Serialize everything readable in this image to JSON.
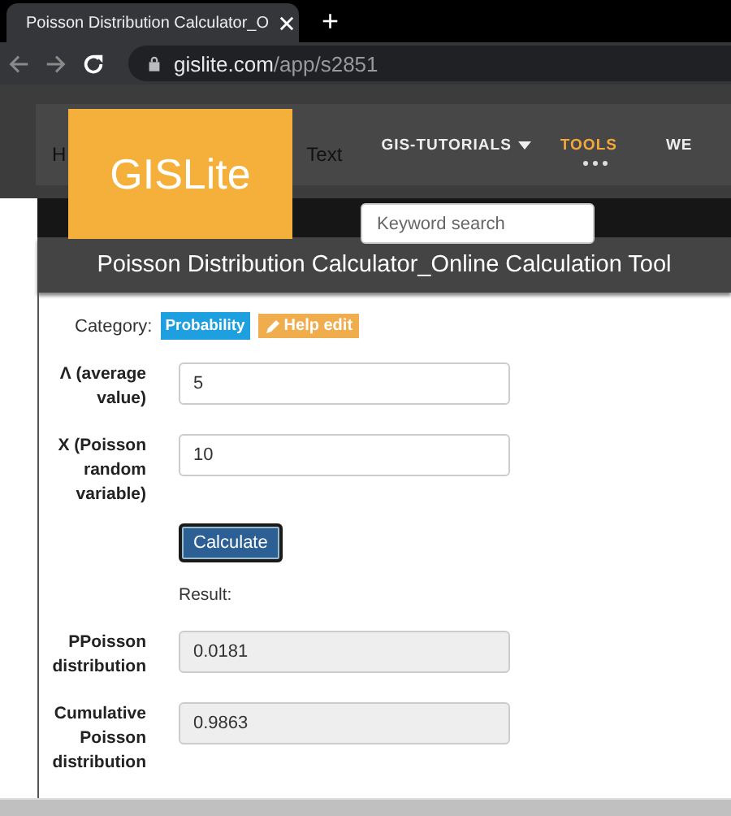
{
  "browser": {
    "tab_title": "Poisson Distribution Calculator_O",
    "new_tab": "+",
    "url_host": "gislite.com",
    "url_path": "/app/s2851"
  },
  "site": {
    "logo": "GISLite",
    "nav": [
      {
        "label": "H",
        "selected": false,
        "kind": "hidden"
      },
      {
        "label": "Text",
        "selected": false,
        "kind": "hidden"
      },
      {
        "label": "GIS-TUTORIALS",
        "selected": false,
        "kind": "dropdown"
      },
      {
        "label": "TOOLS",
        "selected": true,
        "kind": "link"
      },
      {
        "label": "WE",
        "selected": false,
        "kind": "link"
      }
    ],
    "search": {
      "placeholder": "Keyword search"
    }
  },
  "tool": {
    "title": "Poisson Distribution Calculator_Online Calculation Tool",
    "category_label": "Category:",
    "category": "Probability",
    "help": "Help edit",
    "inputs": [
      {
        "label": "Λ (average value)",
        "value": "5"
      },
      {
        "label": "X (Poisson random variable)",
        "value": "10"
      }
    ],
    "button": "Calculate",
    "result_label": "Result:",
    "outputs": [
      {
        "label": "PPoisson distribution",
        "value": "0.0181"
      },
      {
        "label": "Cumulative Poisson distribution",
        "value": "0.9863"
      }
    ]
  }
}
